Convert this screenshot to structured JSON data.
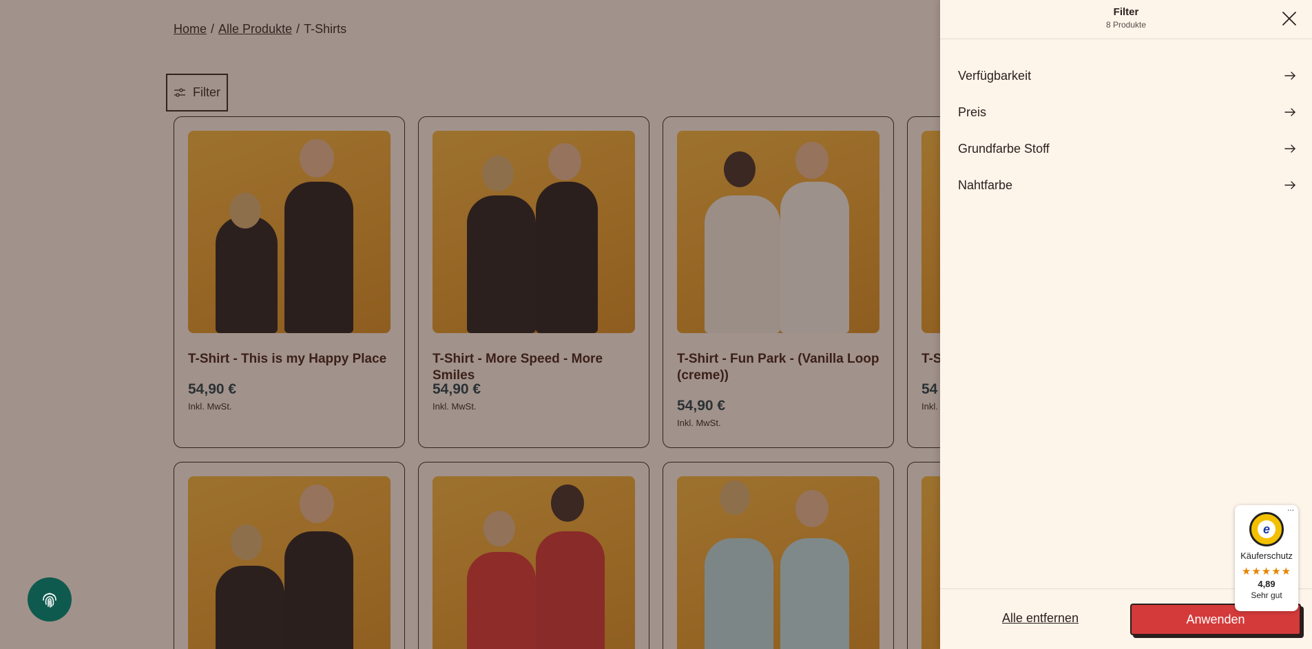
{
  "breadcrumb": {
    "home": "Home",
    "all": "Alle Produkte",
    "current": "T-Shirts"
  },
  "toolbar": {
    "filter_label": "Filter"
  },
  "products": [
    {
      "title": "T-Shirt - This is my Happy Place",
      "price": "54,90 €",
      "tax": "Inkl. MwSt."
    },
    {
      "title": "T-Shirt - More Speed - More Smiles",
      "price": "54,90 €",
      "tax": "Inkl. MwSt."
    },
    {
      "title": "T-Shirt - Fun Park - (Vanilla Loop (creme))",
      "price": "54,90 €",
      "tax": "Inkl. MwSt."
    },
    {
      "title": "T-S",
      "price": "54",
      "tax": "Inkl."
    }
  ],
  "drawer": {
    "title": "Filter",
    "count": "8 Produkte",
    "items": [
      {
        "label": "Verfügbarkeit"
      },
      {
        "label": "Preis"
      },
      {
        "label": "Grundfarbe Stoff"
      },
      {
        "label": "Nahtfarbe"
      }
    ],
    "remove_all": "Alle entfernen",
    "apply": "Anwenden"
  },
  "trust_badge": {
    "label": "Käuferschutz",
    "stars": "★★★★★",
    "score": "4,89",
    "grade": "Sehr gut",
    "more": "..."
  },
  "colors": {
    "accent": "#d43a3a",
    "background": "#fdf4ea",
    "fab": "#0f5a4e",
    "price": "#1a3a44"
  },
  "icons": {
    "filter": "sliders-icon",
    "close": "close-icon",
    "arrow": "arrow-right-icon",
    "fab": "fingerprint-icon"
  }
}
